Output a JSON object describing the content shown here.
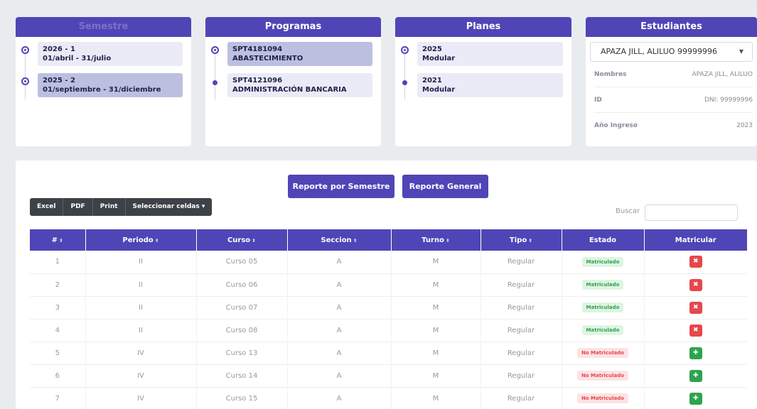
{
  "semestre": {
    "title": "Semestre",
    "items": [
      {
        "code": "2026 - 1",
        "range": "01/abril - 31/julio",
        "active": false
      },
      {
        "code": "2025 - 2",
        "range": "01/septiembre - 31/diciembre",
        "active": true
      }
    ]
  },
  "programas": {
    "title": "Programas",
    "items": [
      {
        "code": "SPT4181094",
        "name": "ABASTECIMIENTO",
        "active": true
      },
      {
        "code": "SPT4121096",
        "name": "ADMINISTRACIÓN BANCARIA",
        "active": false
      }
    ]
  },
  "planes": {
    "title": "Planes",
    "items": [
      {
        "code": "2025",
        "name": "Modular",
        "active": false
      },
      {
        "code": "2021",
        "name": "Modular",
        "active": false
      }
    ]
  },
  "estudiantes": {
    "title": "Estudiantes",
    "selected": "APAZA JILL, ALILUO 99999996",
    "rows": [
      {
        "label": "Nombres",
        "value": "APAZA JILL, ALILUO"
      },
      {
        "label": "ID",
        "value": "DNI: 99999996"
      },
      {
        "label": "Año Ingreso",
        "value": "2023"
      }
    ]
  },
  "actions": {
    "reporte_semestre": "Reporte por Semestre",
    "reporte_general": "Reporte General"
  },
  "toolbar": [
    "Excel",
    "PDF",
    "Print",
    "Seleccionar celdas ▾"
  ],
  "search": {
    "label": "Buscar",
    "value": ""
  },
  "table": {
    "headers": [
      "#",
      "Periodo",
      "Curso",
      "Seccion",
      "Turno",
      "Tipo",
      "Estado",
      "Matricular"
    ],
    "rows": [
      {
        "n": "1",
        "periodo": "II",
        "curso": "Curso 05",
        "seccion": "A",
        "turno": "M",
        "tipo": "Regular",
        "estado": "Matriculado",
        "matriculado": true
      },
      {
        "n": "2",
        "periodo": "II",
        "curso": "Curso 06",
        "seccion": "A",
        "turno": "M",
        "tipo": "Regular",
        "estado": "Matriculado",
        "matriculado": true
      },
      {
        "n": "3",
        "periodo": "II",
        "curso": "Curso 07",
        "seccion": "A",
        "turno": "M",
        "tipo": "Regular",
        "estado": "Matriculado",
        "matriculado": true
      },
      {
        "n": "4",
        "periodo": "II",
        "curso": "Curso 08",
        "seccion": "A",
        "turno": "M",
        "tipo": "Regular",
        "estado": "Matriculado",
        "matriculado": true
      },
      {
        "n": "5",
        "periodo": "IV",
        "curso": "Curso 13",
        "seccion": "A",
        "turno": "M",
        "tipo": "Regular",
        "estado": "No Matriculado",
        "matriculado": false
      },
      {
        "n": "6",
        "periodo": "IV",
        "curso": "Curso 14",
        "seccion": "A",
        "turno": "M",
        "tipo": "Regular",
        "estado": "No Matriculado",
        "matriculado": false
      },
      {
        "n": "7",
        "periodo": "IV",
        "curso": "Curso 15",
        "seccion": "A",
        "turno": "M",
        "tipo": "Regular",
        "estado": "No Matriculado",
        "matriculado": false
      }
    ]
  },
  "colors": {
    "accent": "#4f45b6",
    "success": "#2da44e",
    "danger": "#e5484d"
  }
}
